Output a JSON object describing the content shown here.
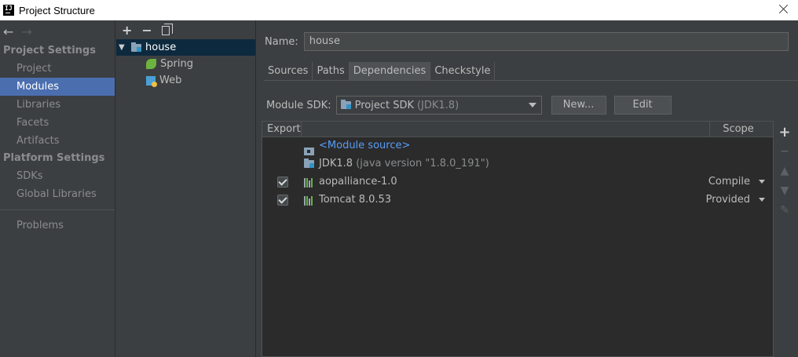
{
  "window": {
    "title": "Project Structure",
    "app_icon_text": "IJ"
  },
  "left_nav": {
    "back": "←",
    "forward": "→",
    "project_settings_title": "Project Settings",
    "project_settings_items": [
      {
        "label": "Project",
        "selected": false
      },
      {
        "label": "Modules",
        "selected": true
      },
      {
        "label": "Libraries",
        "selected": false
      },
      {
        "label": "Facets",
        "selected": false
      },
      {
        "label": "Artifacts",
        "selected": false
      }
    ],
    "platform_settings_title": "Platform Settings",
    "platform_settings_items": [
      {
        "label": "SDKs"
      },
      {
        "label": "Global Libraries"
      }
    ],
    "problems_label": "Problems"
  },
  "module_tree": {
    "add": "+",
    "remove": "−",
    "root": {
      "label": "house",
      "expanded": true
    },
    "children": [
      {
        "label": "Spring",
        "icon": "spring-icon"
      },
      {
        "label": "Web",
        "icon": "web-icon"
      }
    ]
  },
  "module_detail": {
    "name_label": "Name:",
    "name_value": "house",
    "tabs": [
      {
        "label": "Sources",
        "active": false
      },
      {
        "label": "Paths",
        "active": false
      },
      {
        "label": "Dependencies",
        "active": true
      },
      {
        "label": "Checkstyle",
        "active": false
      }
    ],
    "sdk_label": "Module SDK:",
    "sdk_value": "Project SDK",
    "sdk_detail": "(JDK1.8)",
    "new_button": "New...",
    "edit_button": "Edit",
    "table": {
      "col_export": "Export",
      "col_scope": "Scope",
      "rows": [
        {
          "name": "<Module source>",
          "detail": "",
          "checked": false,
          "scope": ""
        },
        {
          "name": "JDK1.8",
          "detail": "(java version \"1.8.0_191\")",
          "checked": false,
          "scope": ""
        },
        {
          "name": "aopalliance-1.0",
          "detail": "",
          "checked": true,
          "scope": "Compile"
        },
        {
          "name": "Tomcat 8.0.53",
          "detail": "",
          "checked": true,
          "scope": "Provided"
        }
      ]
    },
    "side_tools": {
      "add": "+",
      "remove": "−",
      "up": "▲",
      "down": "▼",
      "edit": "✎"
    }
  }
}
